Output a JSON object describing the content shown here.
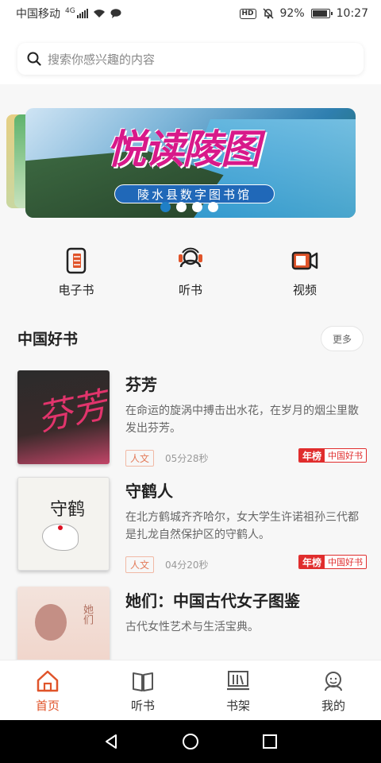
{
  "status_bar": {
    "carrier": "中国移动",
    "net": "4G",
    "hd": "HD",
    "battery": "92%",
    "time": "10:27"
  },
  "search": {
    "placeholder": "搜索你感兴趣的内容"
  },
  "banner": {
    "title": "悦读陵图",
    "subtitle": "陵水县数字图书馆",
    "dot_count": 4,
    "active_dot": 0
  },
  "shortcuts": [
    {
      "label": "电子书",
      "icon": "ebook-icon"
    },
    {
      "label": "听书",
      "icon": "headphones-icon"
    },
    {
      "label": "视频",
      "icon": "video-icon"
    }
  ],
  "section": {
    "title": "中国好书",
    "more": "更多"
  },
  "books": [
    {
      "title": "芬芳",
      "desc": "在命运的旋涡中搏击出水花，在岁月的烟尘里散发出芬芳。",
      "tag": "人文",
      "duration": "05分28秒",
      "badge_left": "年榜",
      "badge_right": "中国好书",
      "cover_text": "芬芳"
    },
    {
      "title": "守鹤人",
      "desc": "在北方鹤城齐齐哈尔，女大学生许诺祖孙三代都是扎龙自然保护区的守鹤人。",
      "tag": "人文",
      "duration": "04分20秒",
      "badge_left": "年榜",
      "badge_right": "中国好书",
      "cover_text": "守鹤"
    },
    {
      "title": "她们：中国古代女子图鉴",
      "desc": "古代女性艺术与生活宝典。",
      "cover_text": "她们"
    }
  ],
  "tabs": [
    {
      "label": "首页",
      "icon": "home-icon",
      "active": true
    },
    {
      "label": "听书",
      "icon": "book-icon",
      "active": false
    },
    {
      "label": "书架",
      "icon": "bookshelf-icon",
      "active": false
    },
    {
      "label": "我的",
      "icon": "profile-icon",
      "active": false
    }
  ],
  "colors": {
    "accent": "#e0542a",
    "badge_red": "#e02d2d",
    "banner_title": "#d8198a"
  }
}
